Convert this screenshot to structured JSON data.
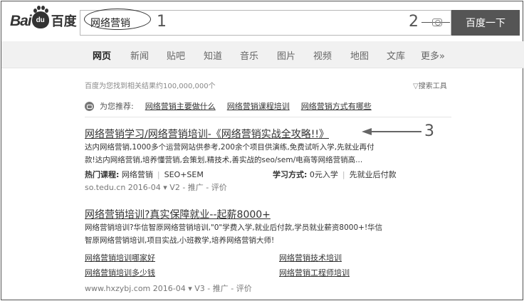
{
  "logo": {
    "bai": "Bai",
    "du": "du",
    "cn": "百度"
  },
  "search": {
    "value": "网络营销",
    "button": "百度一下"
  },
  "annotations": [
    "1",
    "2",
    "3"
  ],
  "nav": [
    "网页",
    "新闻",
    "贴吧",
    "知道",
    "音乐",
    "图片",
    "视频",
    "地图",
    "文库",
    "更多»"
  ],
  "meta": {
    "count_text": "百度为您找到相关结果约100,000,000个",
    "tools": "搜索工具"
  },
  "recommend": {
    "prefix": "为您推荐:",
    "links": [
      "网络营销主要做什么",
      "网络营销课程培训",
      "网络营销方式有哪些"
    ]
  },
  "results": [
    {
      "title": "网络营销学习/网络营销培训-《网络营销实战全攻略!!》",
      "snippet": [
        "达内网络营销,1000多个运营网站供参考,200余个项目供演练,免费试听入学,先就业再付",
        "款!达内网络营销,培养懂营销,会策划,精技术,善实战的seo/sem/电商等网络营销高..."
      ],
      "info": {
        "label1": "热门课程:",
        "course1": "网络营销",
        "course2": "SEO+SEM",
        "label2": "学习方式:",
        "way1": "0元入学",
        "way2": "先就业后付款"
      },
      "url": "so.tedu.cn  2016-04",
      "url_tail": " ▾ V2 - 推广 - 评价"
    },
    {
      "title": "网络营销培训?真实保障就业--起薪8000+",
      "snippet": [
        "网络营销培训?华信智原网络营销培训,\"0\"学费入学,就业后付款,学员就业薪资8000+!华信",
        "智原网络营销培训,项目实战,小班教学,培养网络营销大师!"
      ],
      "sublinks": [
        "网络营销培训哪家好",
        "网络营销技术培训",
        "网络营销培训多少钱",
        "网络营销工程师培训"
      ],
      "url": "www.hxzybj.com  2016-04",
      "url_tail": " ▾ V3 - 推广 - 评价"
    }
  ]
}
